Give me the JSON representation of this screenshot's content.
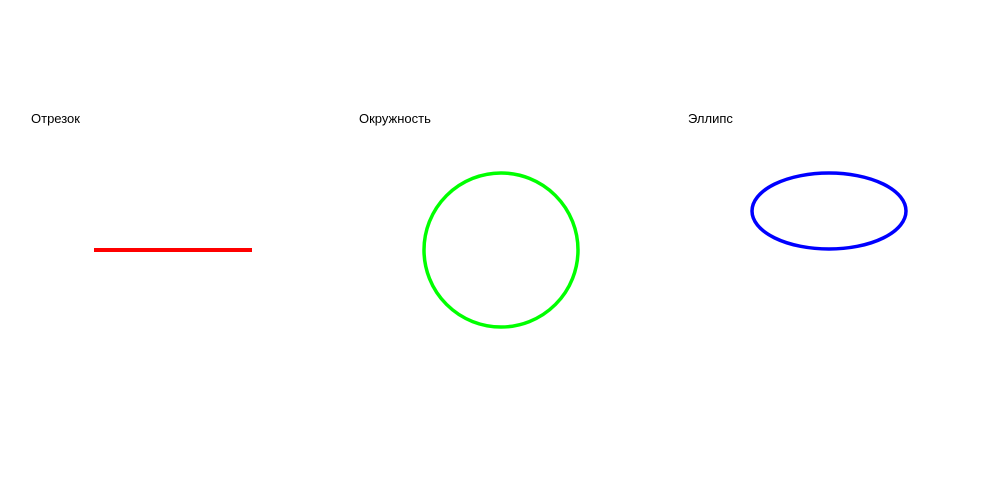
{
  "panels": {
    "segment": {
      "label": "Отрезок",
      "color": "#ff0000"
    },
    "circle": {
      "label": "Окружность",
      "color": "#00ff00"
    },
    "ellipse": {
      "label": "Эллипс",
      "color": "#0000ff"
    }
  }
}
